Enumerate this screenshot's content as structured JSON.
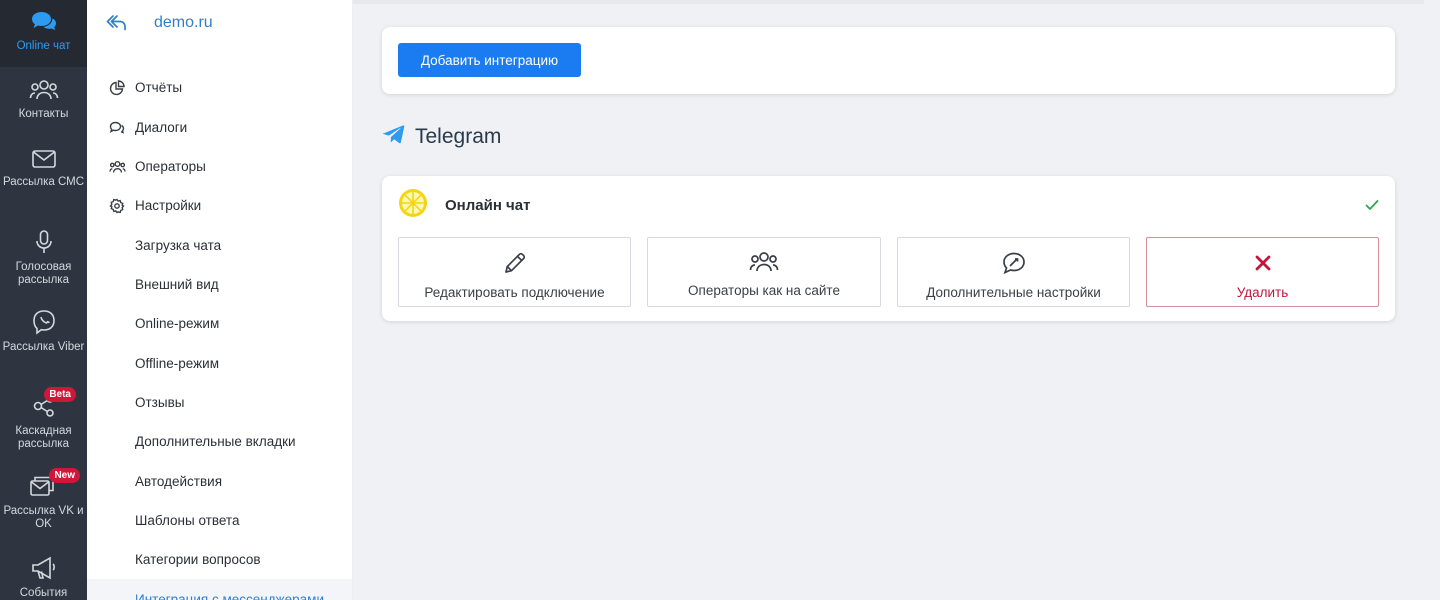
{
  "rail": {
    "items": [
      {
        "label": "Online чат",
        "icon": "chat-bubbles-icon"
      },
      {
        "label": "Контакты",
        "icon": "contacts-icon"
      },
      {
        "label": "Рассылка СМС",
        "icon": "envelope-icon"
      },
      {
        "label": "Голосовая рассылка",
        "icon": "microphone-icon"
      },
      {
        "label": "Рассылка Viber",
        "icon": "viber-icon"
      },
      {
        "label": "Каскадная рассылка",
        "icon": "share-nodes-icon",
        "badge": "Beta"
      },
      {
        "label": "Рассылка VK и OK",
        "icon": "multi-envelope-icon",
        "badge": "New"
      },
      {
        "label": "События",
        "icon": "megaphone-icon"
      }
    ]
  },
  "sidebar": {
    "domain": "demo.ru",
    "items": [
      {
        "label": "Отчёты",
        "icon": "pie-chart-icon"
      },
      {
        "label": "Диалоги",
        "icon": "dialogs-icon"
      },
      {
        "label": "Операторы",
        "icon": "operators-icon"
      },
      {
        "label": "Настройки",
        "icon": "gear-icon"
      }
    ],
    "sub_items": [
      "Загрузка чата",
      "Внешний вид",
      "Online-режим",
      "Offline-режим",
      "Отзывы",
      "Дополнительные вкладки",
      "Автодействия",
      "Шаблоны ответа",
      "Категории вопросов",
      "Интеграция с мессенджерами"
    ]
  },
  "main": {
    "add_button": "Добавить интеграцию",
    "section_title": "Telegram",
    "integration": {
      "name": "Онлайн чат",
      "actions": [
        {
          "label": "Редактировать подключение",
          "icon": "pencil-icon"
        },
        {
          "label": "Операторы как на сайте",
          "icon": "operators-icon"
        },
        {
          "label": "Дополнительные настройки",
          "icon": "settings-chat-icon"
        },
        {
          "label": "Удалить",
          "icon": "delete-x-icon"
        }
      ]
    }
  },
  "colors": {
    "accent": "#1a7cf0",
    "rail_bg": "#2f3540",
    "danger": "#c0173a",
    "success": "#2ea84a"
  }
}
